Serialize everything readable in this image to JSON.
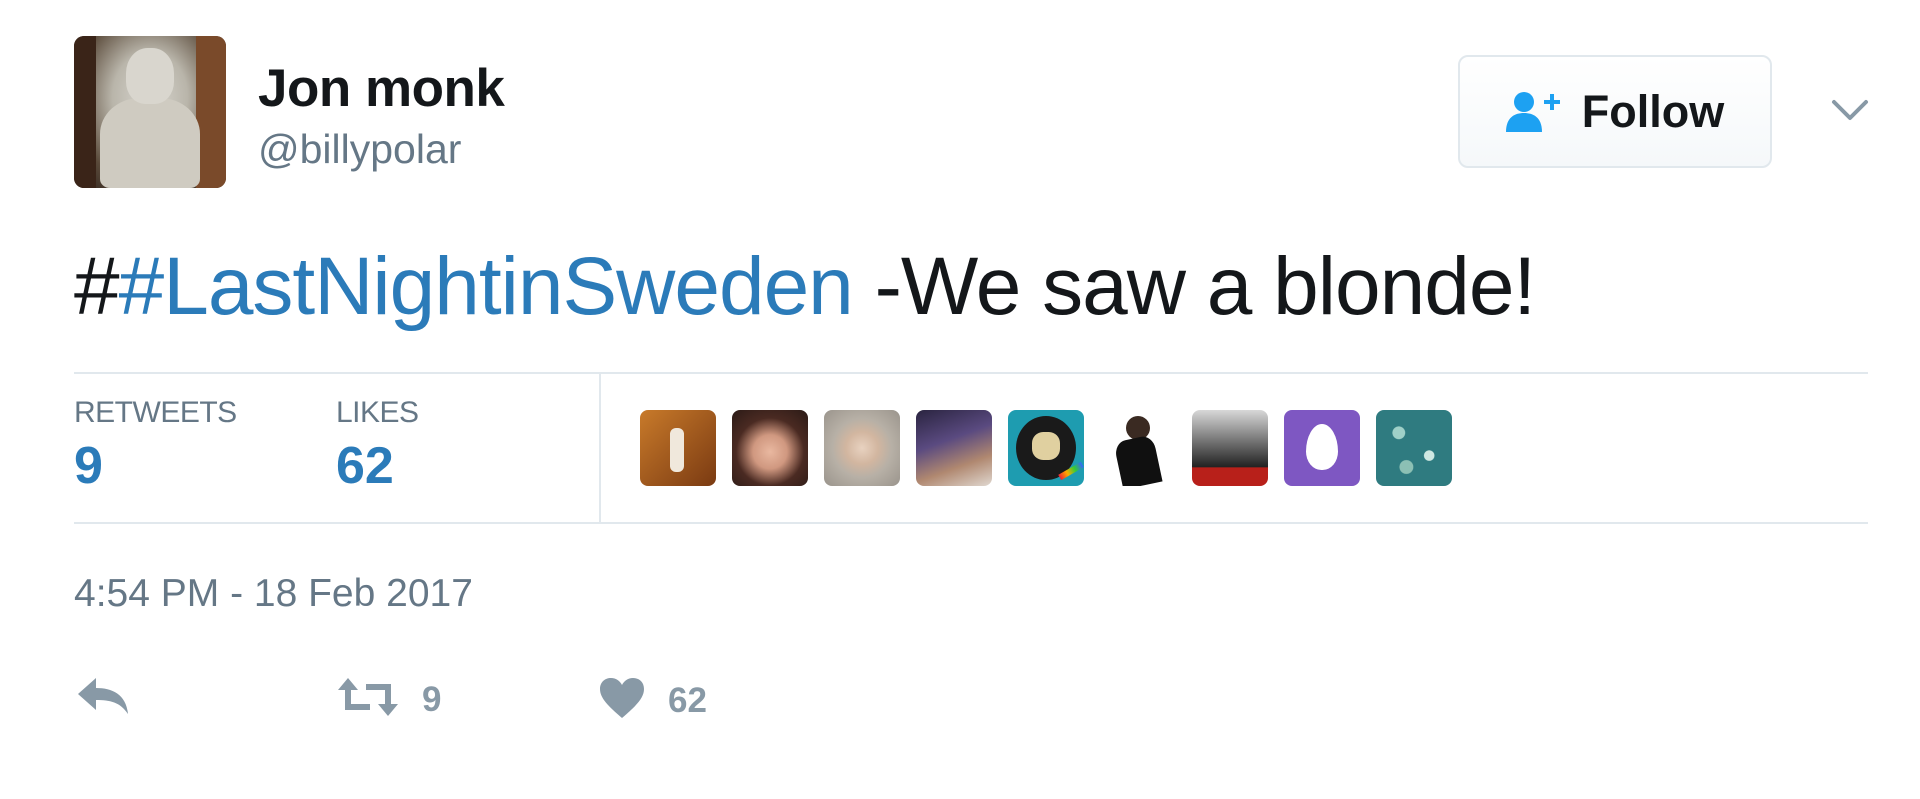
{
  "user": {
    "display_name": "Jon monk",
    "username": "@billypolar"
  },
  "follow_button": {
    "label": "Follow",
    "icon": "follow-user-icon"
  },
  "menu": {
    "icon": "chevron-down-icon"
  },
  "tweet": {
    "text_prefix": "#",
    "hashtag": "#LastNightinSweden",
    "text_rest": " -We saw a blonde!"
  },
  "stats": {
    "retweets_label": "RETWEETS",
    "retweets_value": "9",
    "likes_label": "LIKES",
    "likes_value": "62"
  },
  "likers_count_shown": 9,
  "timestamp": "4:54 PM - 18 Feb 2017",
  "actions": {
    "reply_icon": "reply-icon",
    "retweet_icon": "retweet-icon",
    "retweet_count": "9",
    "like_icon": "heart-icon",
    "like_count": "62"
  },
  "colors": {
    "link": "#2b7bb9",
    "muted": "#657786",
    "action": "#8899a6",
    "border": "#e1e8ed",
    "liker_egg": "#7e57c2"
  }
}
